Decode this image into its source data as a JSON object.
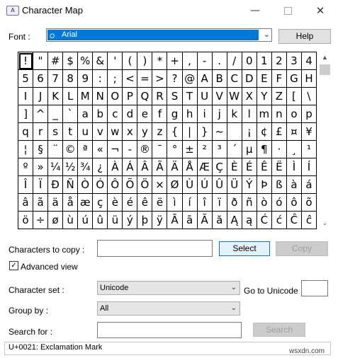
{
  "window": {
    "title": "Character Map",
    "app_icon": "character-map-app-icon",
    "min_glyph": "—",
    "close_glyph": "✕"
  },
  "font": {
    "label": "Font :",
    "value": "Arial",
    "icon_text": "O",
    "dropdown_glyph": "⌄"
  },
  "help_label": "Help",
  "grid": {
    "selected_index": 0,
    "chars": [
      "!",
      "\"",
      "#",
      "$",
      "%",
      "&",
      "'",
      "(",
      ")",
      "*",
      "+",
      ",",
      "-",
      ".",
      "/",
      "0",
      "1",
      "2",
      "3",
      "4",
      "5",
      "6",
      "7",
      "8",
      "9",
      ":",
      ";",
      "<",
      "=",
      ">",
      "?",
      "@",
      "A",
      "B",
      "C",
      "D",
      "E",
      "F",
      "G",
      "H",
      "I",
      "J",
      "K",
      "L",
      "M",
      "N",
      "O",
      "P",
      "Q",
      "R",
      "S",
      "T",
      "U",
      "V",
      "W",
      "X",
      "Y",
      "Z",
      "[",
      "\\",
      "]",
      "^",
      "_",
      "`",
      "a",
      "b",
      "c",
      "d",
      "e",
      "f",
      "g",
      "h",
      "i",
      "j",
      "k",
      "l",
      "m",
      "n",
      "o",
      "p",
      "q",
      "r",
      "s",
      "t",
      "u",
      "v",
      "w",
      "x",
      "y",
      "z",
      "{",
      "|",
      "}",
      "~",
      " ",
      "¡",
      "¢",
      "£",
      "¤",
      "¥",
      "¦",
      "§",
      "¨",
      "©",
      "ª",
      "«",
      "¬",
      "-",
      "®",
      "¯",
      "°",
      "±",
      "²",
      "³",
      "´",
      "µ",
      "¶",
      "·",
      "¸",
      "¹",
      "º",
      "»",
      "¼",
      "½",
      "¾",
      "¿",
      "À",
      "Á",
      "Â",
      "Ã",
      "Ä",
      "Å",
      "Æ",
      "Ç",
      "È",
      "É",
      "Ê",
      "Ë",
      "Ì",
      "Í",
      "Î",
      "Ï",
      "Ð",
      "Ñ",
      "Ò",
      "Ó",
      "Ô",
      "Õ",
      "Ö",
      "×",
      "Ø",
      "Ù",
      "Ú",
      "Û",
      "Ü",
      "Ý",
      "Þ",
      "ß",
      "à",
      "á",
      "â",
      "ã",
      "ä",
      "å",
      "æ",
      "ç",
      "è",
      "é",
      "ê",
      "ë",
      "ì",
      "í",
      "î",
      "ï",
      "ð",
      "ñ",
      "ò",
      "ó",
      "ô",
      "õ",
      "ö",
      "÷",
      "ø",
      "ù",
      "ú",
      "û",
      "ü",
      "ý",
      "þ",
      "ÿ",
      "Ā",
      "ā",
      "Ă",
      "ă",
      "Ą",
      "ą",
      "Ć",
      "ć",
      "Ĉ",
      "ĉ"
    ]
  },
  "scrollbar": {
    "up_glyph": "▲",
    "down_glyph": "⌄"
  },
  "copy": {
    "label": "Characters to copy :",
    "value": "",
    "select_label": "Select",
    "copy_label": "Copy"
  },
  "advanced": {
    "checked": true,
    "check_glyph": "✓",
    "label": "Advanced view"
  },
  "character_set": {
    "label": "Character set :",
    "value": "Unicode",
    "arrow_glyph": "⌄"
  },
  "go_to_unicode": {
    "label": "Go to Unicode :",
    "value": ""
  },
  "group_by": {
    "label": "Group by :",
    "value": "All",
    "arrow_glyph": "⌄"
  },
  "search": {
    "label": "Search for :",
    "value": "",
    "button_label": "Search"
  },
  "status": {
    "text": "U+0021: Exclamation Mark"
  },
  "watermark": "wsxdn.com"
}
